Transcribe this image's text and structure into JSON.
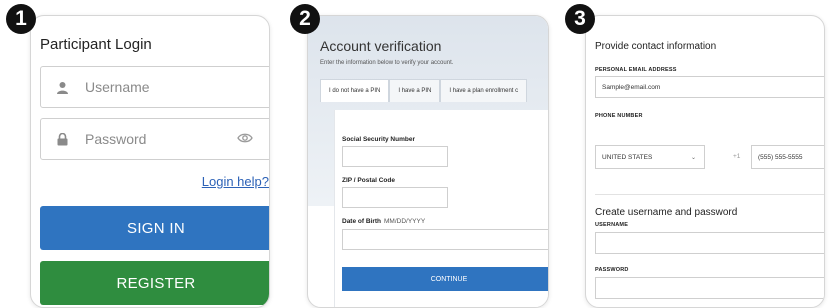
{
  "steps": [
    "1",
    "2",
    "3"
  ],
  "login": {
    "title": "Participant Login",
    "username_placeholder": "Username",
    "password_placeholder": "Password",
    "help_link": "Login help?",
    "signin_label": "SIGN IN",
    "register_label": "REGISTER"
  },
  "verification": {
    "title": "Account verification",
    "subtitle": "Enter the information below to verify your account.",
    "tabs": [
      "I do not have a PIN",
      "I have a PIN",
      "I have a plan enrollment c"
    ],
    "ssn_label": "Social Security Number",
    "zip_label": "ZIP / Postal Code",
    "dob_label": "Date of Birth",
    "dob_hint": "MM/DD/YYYY",
    "continue_label": "CONTINUE"
  },
  "contact": {
    "title": "Provide contact information",
    "email_label": "PERSONAL EMAIL ADDRESS",
    "email_value": "Sample@email.com",
    "phone_label": "PHONE NUMBER",
    "country_value": "UNITED STATES",
    "country_code": "+1",
    "phone_value": "(555) 555-5555",
    "section2_title": "Create username and password",
    "username_label": "USERNAME",
    "password_label": "PASSWORD"
  },
  "colors": {
    "primary": "#2f74c0",
    "register": "#2f8d3f",
    "link": "#2d62b7"
  }
}
